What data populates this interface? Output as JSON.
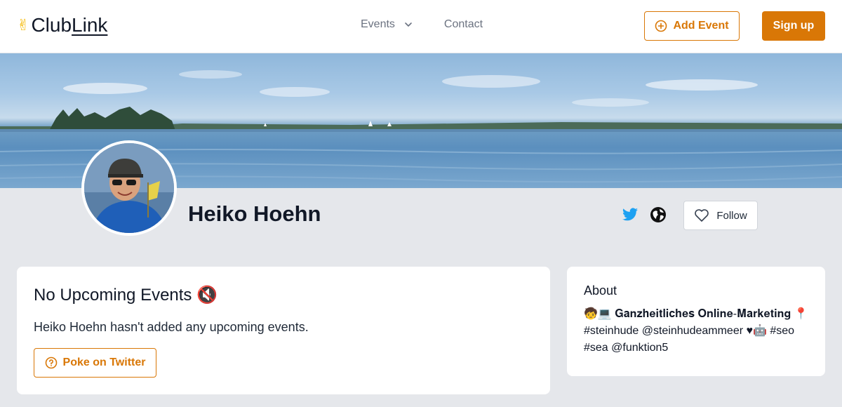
{
  "header": {
    "logo_emoji": "✌",
    "logo_part1": "Club",
    "logo_part2": "Link",
    "nav_events": "Events",
    "nav_contact": "Contact",
    "add_event_label": "Add Event",
    "signup_label": "Sign up"
  },
  "profile": {
    "name": "Heiko Hoehn",
    "follow_label": "Follow"
  },
  "events": {
    "title": "No Upcoming Events 🔇",
    "message": "Heiko Hoehn hasn't added any upcoming events.",
    "poke_label": "Poke on Twitter"
  },
  "about": {
    "title": "About",
    "text": "🧒💻 𝐆𝐚𝐧𝐳𝐡𝐞𝐢𝐭𝐥𝐢𝐜𝐡𝐞𝐬 𝐎𝐧𝐥𝐢𝐧𝐞-𝐌𝐚𝐫𝐤𝐞𝐭𝐢𝐧𝐠 📍 #steinhude @steinhudeammeer ♥🤖 #seo #sea @funktion5"
  },
  "colors": {
    "accent": "#d97706",
    "twitter": "#1da1f2",
    "background": "#e5e7eb"
  },
  "icons": {
    "add_event": "plus-circle-icon",
    "follow": "heart-icon",
    "poke": "question-circle-icon",
    "social": [
      "twitter-icon",
      "globe-icon"
    ]
  }
}
